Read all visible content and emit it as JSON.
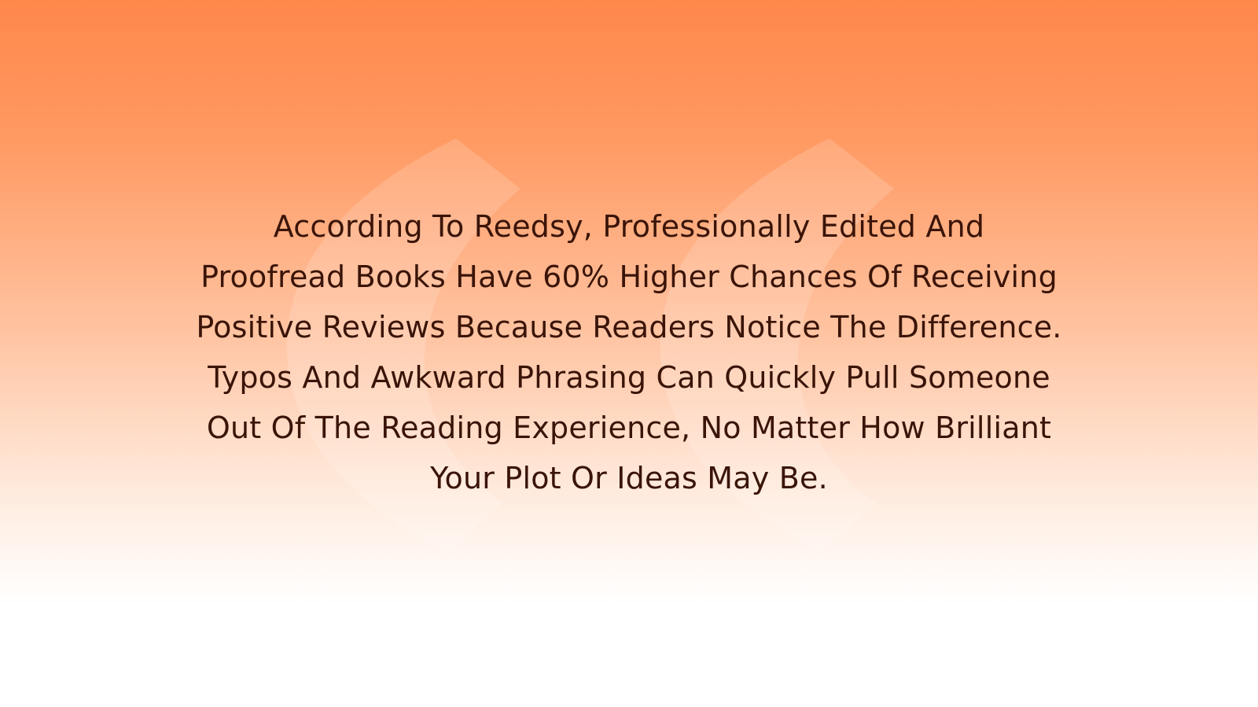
{
  "quote": {
    "lines": [
      "According To Reedsy, Professionally Edited And",
      "Proofread Books Have 60% Higher Chances Of Receiving",
      "Positive Reviews Because Readers Notice The Difference.",
      "Typos And Awkward Phrasing Can Quickly Pull Someone",
      "Out Of The Reading Experience, No Matter How Brilliant",
      "Your Plot Or Ideas May Be."
    ]
  },
  "colors": {
    "gradient_top": "#ff874a",
    "gradient_bottom": "#ffffff",
    "text": "#3a1408"
  },
  "decoration": {
    "icon": "quotation-mark-icon"
  }
}
